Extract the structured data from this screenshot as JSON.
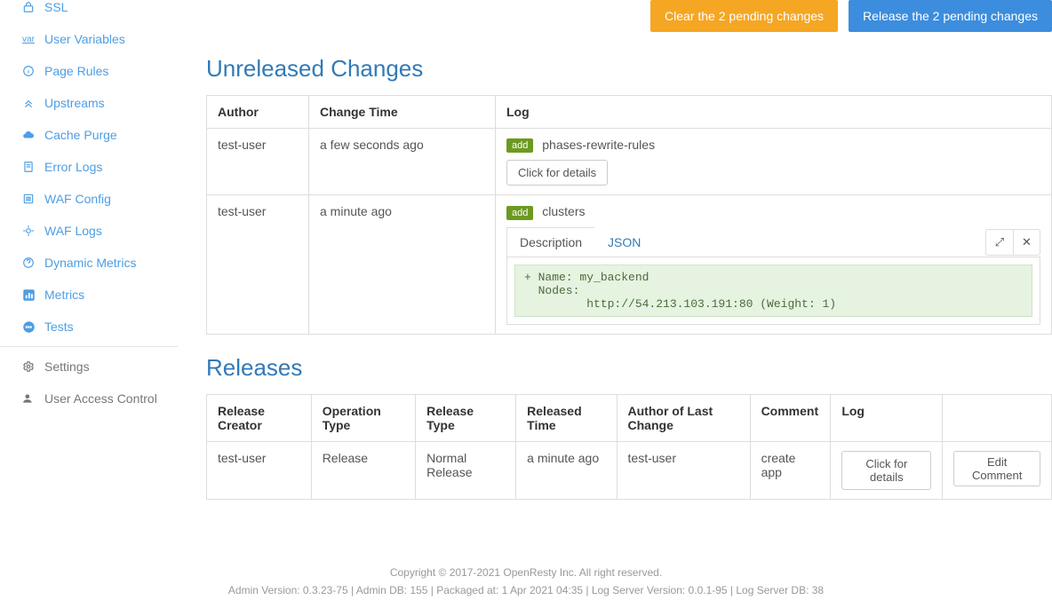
{
  "sidebar": {
    "items": [
      {
        "label": "SSL"
      },
      {
        "label": "User Variables"
      },
      {
        "label": "Page Rules"
      },
      {
        "label": "Upstreams"
      },
      {
        "label": "Cache Purge"
      },
      {
        "label": "Error Logs"
      },
      {
        "label": "WAF Config"
      },
      {
        "label": "WAF Logs"
      },
      {
        "label": "Dynamic Metrics"
      },
      {
        "label": "Metrics"
      },
      {
        "label": "Tests"
      }
    ],
    "settings": "Settings",
    "uac": "User Access Control"
  },
  "actions": {
    "clear": "Clear the 2 pending changes",
    "release": "Release the 2 pending changes"
  },
  "unreleased": {
    "title": "Unreleased Changes",
    "headers": {
      "author": "Author",
      "time": "Change Time",
      "log": "Log"
    },
    "rows": [
      {
        "author": "test-user",
        "time": "a few seconds ago",
        "badge": "add",
        "target": "phases-rewrite-rules",
        "details_btn": "Click for details"
      },
      {
        "author": "test-user",
        "time": "a minute ago",
        "badge": "add",
        "target": "clusters",
        "tabs": {
          "desc": "Description",
          "json": "JSON"
        },
        "code_line1": "+ Name: my_backend",
        "code_line2": "  Nodes:",
        "code_line3": "         http://54.213.103.191:80 (Weight: 1)"
      }
    ]
  },
  "releases": {
    "title": "Releases",
    "headers": {
      "creator": "Release Creator",
      "op_type": "Operation Type",
      "rel_type": "Release Type",
      "rel_time": "Released Time",
      "last_author": "Author of Last Change",
      "comment": "Comment",
      "log": "Log"
    },
    "rows": [
      {
        "creator": "test-user",
        "op_type": "Release",
        "rel_type": "Normal Release",
        "rel_time": "a minute ago",
        "last_author": "test-user",
        "comment": "create app",
        "log_btn": "Click for details",
        "edit_btn": "Edit Comment"
      }
    ]
  },
  "footer": {
    "line1": "Copyright © 2017-2021 OpenResty Inc. All right reserved.",
    "line2": "Admin Version: 0.3.23-75  |  Admin DB: 155  |  Packaged at: 1 Apr 2021 04:35  |  Log Server Version: 0.0.1-95  |  Log Server DB: 38"
  }
}
